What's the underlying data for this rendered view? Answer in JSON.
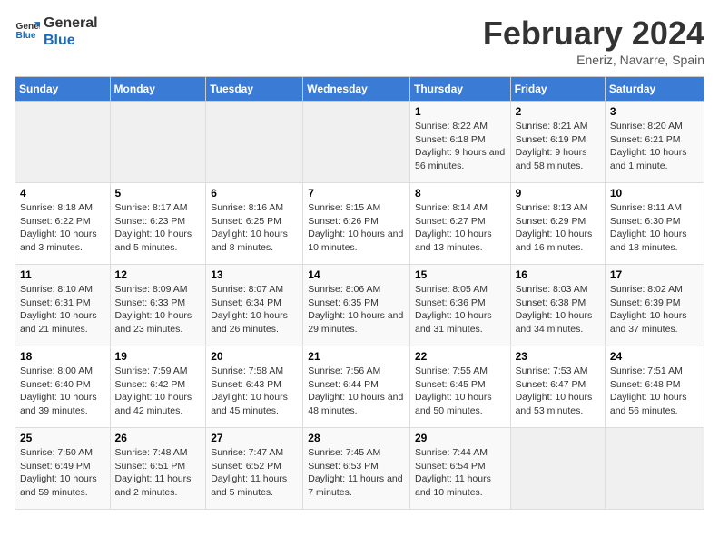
{
  "header": {
    "logo_line1": "General",
    "logo_line2": "Blue",
    "month_year": "February 2024",
    "location": "Eneriz, Navarre, Spain"
  },
  "weekdays": [
    "Sunday",
    "Monday",
    "Tuesday",
    "Wednesday",
    "Thursday",
    "Friday",
    "Saturday"
  ],
  "weeks": [
    [
      {
        "day": "",
        "info": ""
      },
      {
        "day": "",
        "info": ""
      },
      {
        "day": "",
        "info": ""
      },
      {
        "day": "",
        "info": ""
      },
      {
        "day": "1",
        "info": "Sunrise: 8:22 AM\nSunset: 6:18 PM\nDaylight: 9 hours and 56 minutes."
      },
      {
        "day": "2",
        "info": "Sunrise: 8:21 AM\nSunset: 6:19 PM\nDaylight: 9 hours and 58 minutes."
      },
      {
        "day": "3",
        "info": "Sunrise: 8:20 AM\nSunset: 6:21 PM\nDaylight: 10 hours and 1 minute."
      }
    ],
    [
      {
        "day": "4",
        "info": "Sunrise: 8:18 AM\nSunset: 6:22 PM\nDaylight: 10 hours and 3 minutes."
      },
      {
        "day": "5",
        "info": "Sunrise: 8:17 AM\nSunset: 6:23 PM\nDaylight: 10 hours and 5 minutes."
      },
      {
        "day": "6",
        "info": "Sunrise: 8:16 AM\nSunset: 6:25 PM\nDaylight: 10 hours and 8 minutes."
      },
      {
        "day": "7",
        "info": "Sunrise: 8:15 AM\nSunset: 6:26 PM\nDaylight: 10 hours and 10 minutes."
      },
      {
        "day": "8",
        "info": "Sunrise: 8:14 AM\nSunset: 6:27 PM\nDaylight: 10 hours and 13 minutes."
      },
      {
        "day": "9",
        "info": "Sunrise: 8:13 AM\nSunset: 6:29 PM\nDaylight: 10 hours and 16 minutes."
      },
      {
        "day": "10",
        "info": "Sunrise: 8:11 AM\nSunset: 6:30 PM\nDaylight: 10 hours and 18 minutes."
      }
    ],
    [
      {
        "day": "11",
        "info": "Sunrise: 8:10 AM\nSunset: 6:31 PM\nDaylight: 10 hours and 21 minutes."
      },
      {
        "day": "12",
        "info": "Sunrise: 8:09 AM\nSunset: 6:33 PM\nDaylight: 10 hours and 23 minutes."
      },
      {
        "day": "13",
        "info": "Sunrise: 8:07 AM\nSunset: 6:34 PM\nDaylight: 10 hours and 26 minutes."
      },
      {
        "day": "14",
        "info": "Sunrise: 8:06 AM\nSunset: 6:35 PM\nDaylight: 10 hours and 29 minutes."
      },
      {
        "day": "15",
        "info": "Sunrise: 8:05 AM\nSunset: 6:36 PM\nDaylight: 10 hours and 31 minutes."
      },
      {
        "day": "16",
        "info": "Sunrise: 8:03 AM\nSunset: 6:38 PM\nDaylight: 10 hours and 34 minutes."
      },
      {
        "day": "17",
        "info": "Sunrise: 8:02 AM\nSunset: 6:39 PM\nDaylight: 10 hours and 37 minutes."
      }
    ],
    [
      {
        "day": "18",
        "info": "Sunrise: 8:00 AM\nSunset: 6:40 PM\nDaylight: 10 hours and 39 minutes."
      },
      {
        "day": "19",
        "info": "Sunrise: 7:59 AM\nSunset: 6:42 PM\nDaylight: 10 hours and 42 minutes."
      },
      {
        "day": "20",
        "info": "Sunrise: 7:58 AM\nSunset: 6:43 PM\nDaylight: 10 hours and 45 minutes."
      },
      {
        "day": "21",
        "info": "Sunrise: 7:56 AM\nSunset: 6:44 PM\nDaylight: 10 hours and 48 minutes."
      },
      {
        "day": "22",
        "info": "Sunrise: 7:55 AM\nSunset: 6:45 PM\nDaylight: 10 hours and 50 minutes."
      },
      {
        "day": "23",
        "info": "Sunrise: 7:53 AM\nSunset: 6:47 PM\nDaylight: 10 hours and 53 minutes."
      },
      {
        "day": "24",
        "info": "Sunrise: 7:51 AM\nSunset: 6:48 PM\nDaylight: 10 hours and 56 minutes."
      }
    ],
    [
      {
        "day": "25",
        "info": "Sunrise: 7:50 AM\nSunset: 6:49 PM\nDaylight: 10 hours and 59 minutes."
      },
      {
        "day": "26",
        "info": "Sunrise: 7:48 AM\nSunset: 6:51 PM\nDaylight: 11 hours and 2 minutes."
      },
      {
        "day": "27",
        "info": "Sunrise: 7:47 AM\nSunset: 6:52 PM\nDaylight: 11 hours and 5 minutes."
      },
      {
        "day": "28",
        "info": "Sunrise: 7:45 AM\nSunset: 6:53 PM\nDaylight: 11 hours and 7 minutes."
      },
      {
        "day": "29",
        "info": "Sunrise: 7:44 AM\nSunset: 6:54 PM\nDaylight: 11 hours and 10 minutes."
      },
      {
        "day": "",
        "info": ""
      },
      {
        "day": "",
        "info": ""
      }
    ]
  ]
}
